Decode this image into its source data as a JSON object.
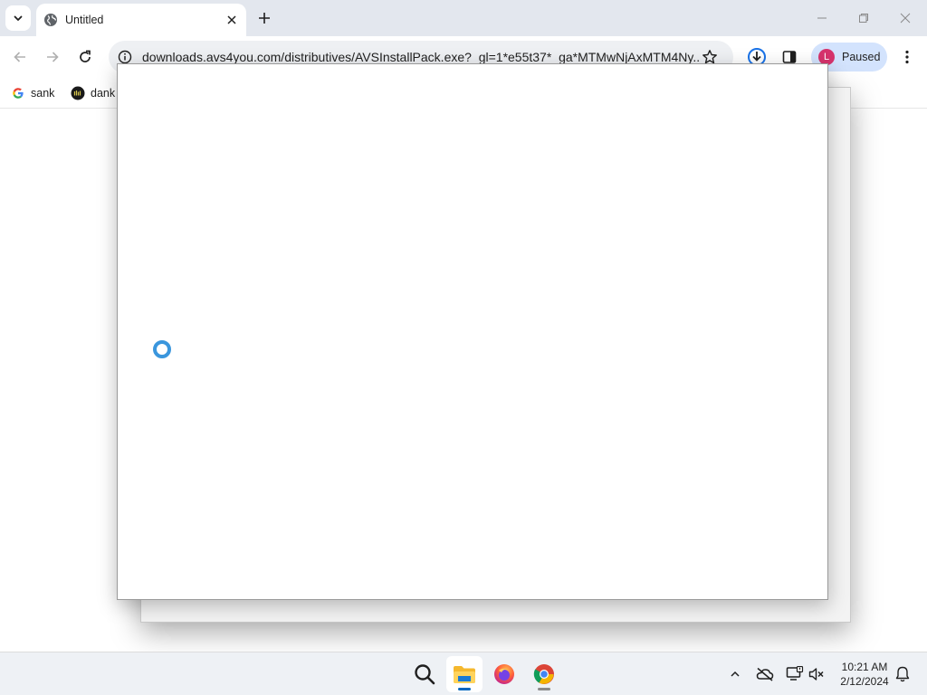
{
  "browser": {
    "tab": {
      "title": "Untitled"
    },
    "omnibox": {
      "url": "downloads.avs4you.com/distributives/AVSInstallPack.exe?_gl=1*e55t37*_ga*MTMwNjAxMTM4Ny..."
    },
    "profile": {
      "initial": "L",
      "label": "Paused"
    },
    "bookmarks": [
      {
        "label": "sank",
        "icon": "google-icon"
      },
      {
        "label": "dank",
        "icon": "dank-icon"
      }
    ]
  },
  "dialog": {
    "state": "loading"
  },
  "taskbar": {
    "apps": [
      "search",
      "file-explorer",
      "firefox",
      "chrome"
    ],
    "clock": {
      "time": "10:21 AM",
      "date": "2/12/2024"
    }
  },
  "colors": {
    "tab_strip": "#e3e7ee",
    "omnibox": "#eef0f3",
    "profile_chip": "#d3e3fd",
    "avatar": "#d6336c",
    "spinner": "#3a96dd"
  }
}
